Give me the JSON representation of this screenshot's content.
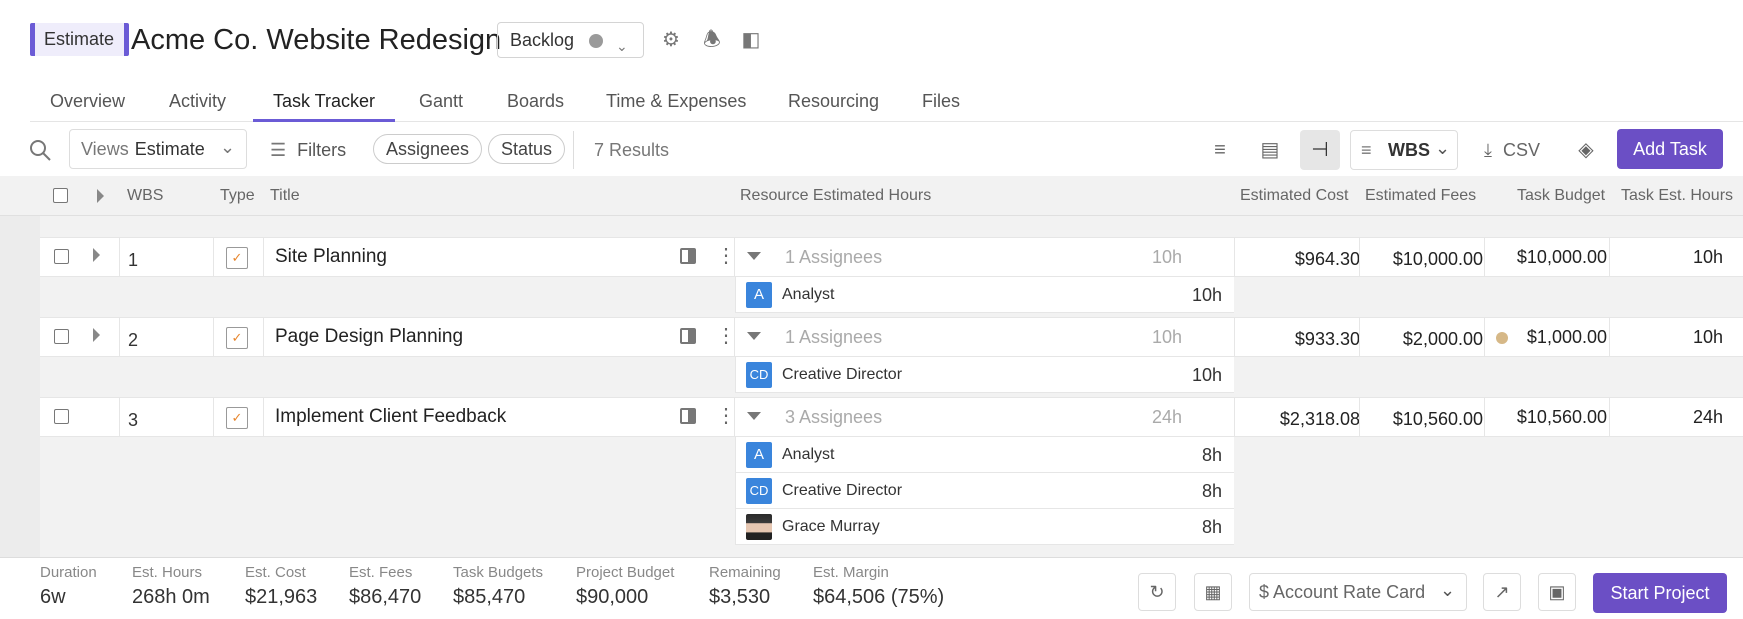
{
  "header": {
    "badge": "Estimate",
    "title": "Acme Co. Website Redesign",
    "status": "Backlog",
    "icons": [
      "gear-icon",
      "bell-icon",
      "side-panel-icon"
    ]
  },
  "tabs": [
    "Overview",
    "Activity",
    "Task Tracker",
    "Gantt",
    "Boards",
    "Time & Expenses",
    "Resourcing",
    "Files"
  ],
  "active_tab": "Task Tracker",
  "toolbar": {
    "views_label": "Views",
    "views_value": "Estimate",
    "filters": "Filters",
    "assignees": "Assignees",
    "status": "Status",
    "results": "7 Results",
    "group_value": "WBS",
    "csv": "CSV",
    "add_task": "Add Task"
  },
  "columns": {
    "wbs": "WBS",
    "type": "Type",
    "title": "Title",
    "resource": "Resource Estimated Hours",
    "est_cost": "Estimated Cost",
    "est_fees": "Estimated Fees",
    "task_budget": "Task Budget",
    "task_hours": "Task Est. Hours"
  },
  "tasks": [
    {
      "wbs": "1",
      "title": "Site Planning",
      "assignees": "1 Assignees",
      "res_hours": "10h",
      "est_cost": "$964.30",
      "est_fees": "$10,000.00",
      "task_budget": "$10,000.00",
      "task_hours": "10h",
      "resources": [
        {
          "initials": "A",
          "name": "Analyst",
          "hours": "10h"
        }
      ]
    },
    {
      "wbs": "2",
      "title": "Page Design Planning",
      "assignees": "1 Assignees",
      "res_hours": "10h",
      "est_cost": "$933.30",
      "est_fees": "$2,000.00",
      "task_budget": "$1,000.00",
      "task_hours": "10h",
      "resources": [
        {
          "initials": "CD",
          "name": "Creative Director",
          "hours": "10h"
        }
      ]
    },
    {
      "wbs": "3",
      "title": "Implement Client Feedback",
      "assignees": "3 Assignees",
      "res_hours": "24h",
      "est_cost": "$2,318.08",
      "est_fees": "$10,560.00",
      "task_budget": "$10,560.00",
      "task_hours": "24h",
      "resources": [
        {
          "initials": "A",
          "name": "Analyst",
          "hours": "8h"
        },
        {
          "initials": "CD",
          "name": "Creative Director",
          "hours": "8h"
        },
        {
          "initials": "",
          "name": "Grace Murray",
          "hours": "8h"
        }
      ]
    }
  ],
  "footer": {
    "stats": [
      {
        "label": "Duration",
        "value": "6w"
      },
      {
        "label": "Est. Hours",
        "value": "268h 0m"
      },
      {
        "label": "Est. Cost",
        "value": "$21,963"
      },
      {
        "label": "Est. Fees",
        "value": "$86,470"
      },
      {
        "label": "Task Budgets",
        "value": "$85,470"
      },
      {
        "label": "Project Budget",
        "value": "$90,000"
      },
      {
        "label": "Remaining",
        "value": "$3,530"
      },
      {
        "label": "Est. Margin",
        "value": "$64,506 (75%)"
      }
    ],
    "rate_card": "$ Account Rate Card",
    "start_project": "Start Project"
  },
  "colors": {
    "accent": "#6b4fc5",
    "badge_border": "#6b5bd6",
    "avatar": "#3a85dc",
    "task_type_check": "#e8862c"
  }
}
